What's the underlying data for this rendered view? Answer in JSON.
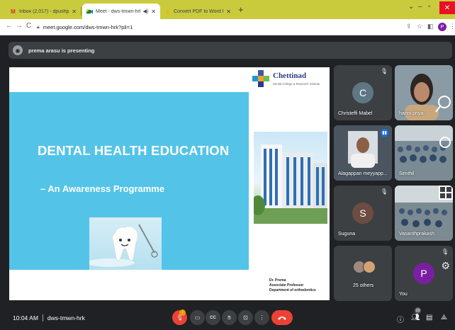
{
  "browser": {
    "tabs": [
      {
        "label": "Inbox (2,017) - dpushpalatha@c",
        "icon": "gmail-icon"
      },
      {
        "label": "Meet - dws-tmwn-hrk",
        "icon": "meet-icon"
      },
      {
        "label": "Convert PDF to Word Free Online",
        "icon": "pdf-converter-icon"
      }
    ],
    "url": "meet.google.com/dws-tmwn-hrk?pli=1",
    "profile_initial": "P"
  },
  "meeting": {
    "presenter_text": "prema arasu is presenting",
    "time": "10:04 AM",
    "code": "dws-tmwn-hrk",
    "participant_count": "33",
    "mic_badge": "!"
  },
  "slide": {
    "logo_name": "Chettinad",
    "logo_subtitle": "Dental College & Research Institute",
    "title": "DENTAL HEALTH EDUCATION",
    "subtitle": "– An Awareness Programme",
    "credits": [
      "Dr. Prema",
      "Associate Professor",
      "Department of orthodontics"
    ]
  },
  "participants": [
    {
      "name": "Christeffi Mabel",
      "initial": "C",
      "avatar_color": "#5f7785",
      "muted": true
    },
    {
      "name": "harini priya",
      "video": true
    },
    {
      "name": "Alagappan meyyapp...",
      "video": true,
      "speaking": true
    },
    {
      "name": "Senthil",
      "video": true
    },
    {
      "name": "Suguna",
      "initial": "S",
      "avatar_color": "#6d4c41",
      "muted": true
    },
    {
      "name": "Vasanthprakash",
      "video": true
    },
    {
      "name": "25 others"
    },
    {
      "name": "You",
      "initial": "P",
      "avatar_color": "#7b1fa2",
      "muted": true
    }
  ],
  "colors": {
    "meet_background": "#202124",
    "tile": "#3c4043",
    "leave": "#ea4335",
    "slide_blue": "#53c4e8",
    "speaking": "#1a73e8"
  }
}
